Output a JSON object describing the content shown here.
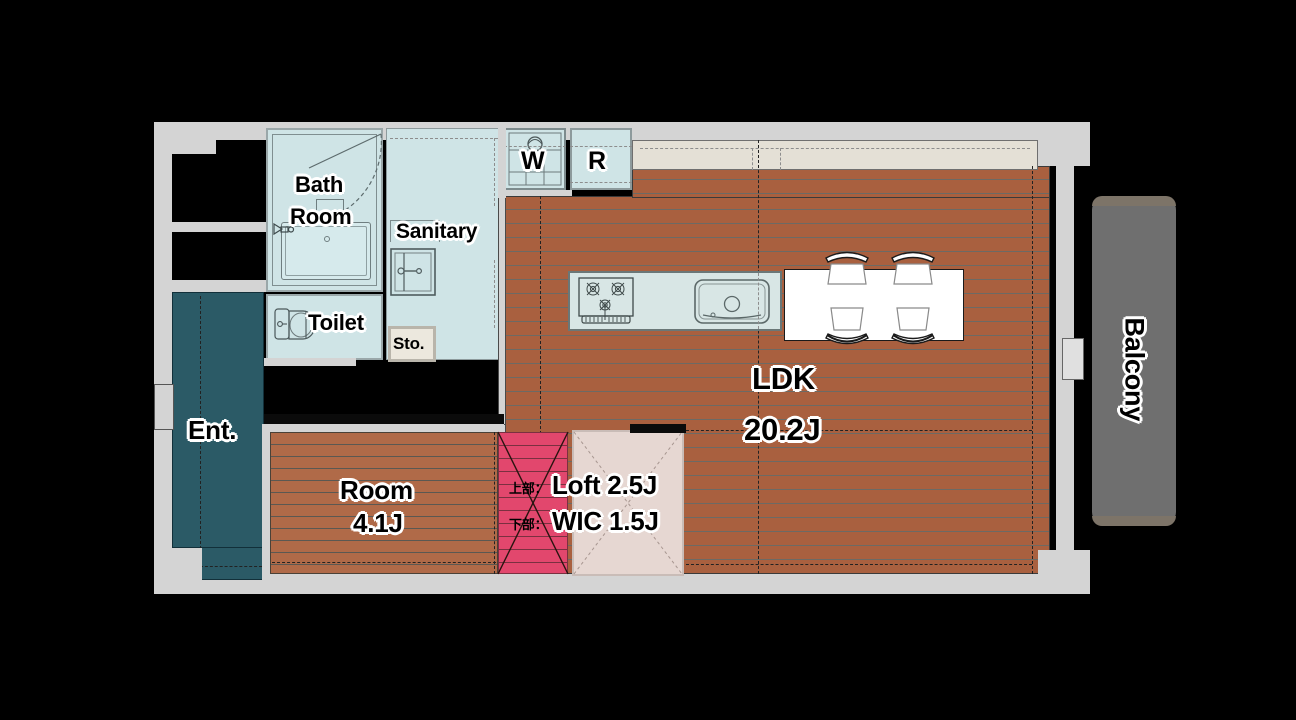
{
  "plan": {
    "title": "apartment-floor-plan",
    "background_color": "#000000"
  },
  "rooms": [
    {
      "key": "bath",
      "name": "bath-room",
      "label_line1": "Bath",
      "label_line2": "Room",
      "fill": "#cfe4e6"
    },
    {
      "key": "toilet",
      "name": "toilet",
      "label_line1": "Toilet",
      "label_line2": "",
      "fill": "#cfe4e6"
    },
    {
      "key": "sanitary",
      "name": "sanitary",
      "label_line1": "Sanitary",
      "label_line2": "",
      "fill": "#cfe4e6"
    },
    {
      "key": "storage",
      "name": "storage",
      "label_line1": "Sto.",
      "label_line2": "",
      "fill": "#ece8de"
    },
    {
      "key": "ldk",
      "name": "ldk",
      "label_line1": "LDK",
      "label_line2": "20.2J",
      "fill": "#a9603f"
    },
    {
      "key": "room",
      "name": "japanese-room",
      "label_line1": "Room",
      "label_line2": "4.1J",
      "fill": "#b06a48"
    },
    {
      "key": "entrance",
      "name": "entrance",
      "label_line1": "Ent.",
      "label_line2": "",
      "fill": "#2b5a66"
    },
    {
      "key": "balcony",
      "name": "balcony",
      "label_line1": "Balcony",
      "label_line2": "",
      "fill": "#6f6f6f"
    }
  ],
  "labels": {
    "bath_line1": "Bath",
    "bath_line2": "Room",
    "toilet": "Toilet",
    "sanitary": "Sanitary",
    "storage": "Sto.",
    "washer": "W",
    "refrigerator": "R",
    "ldk_name": "LDK",
    "ldk_area": "20.2J",
    "room_name": "Room",
    "room_area": "4.1J",
    "loft_prefix": "上部：",
    "loft_text": "Loft 2.5J",
    "wic_prefix": "下部：",
    "wic_text": "WIC 1.5J",
    "entrance": "Ent.",
    "balcony": "Balcony"
  },
  "appliances": {
    "washer_label": "W",
    "refrigerator_label": "R",
    "stove_burners": 3,
    "sink": "kitchen-sink",
    "dining_chairs": 4
  },
  "colors": {
    "wall": "#d4d4d4",
    "void": "#000000",
    "wet_area": "#cfe4e6",
    "ldk_floor": "#a9603f",
    "room_floor": "#b06a48",
    "entrance": "#2b5a66",
    "balcony": "#6f6f6f",
    "stair": "#e2476d",
    "wic": "#e6d7d2",
    "counter": "#e4e0d6",
    "table": "#ffffff"
  }
}
